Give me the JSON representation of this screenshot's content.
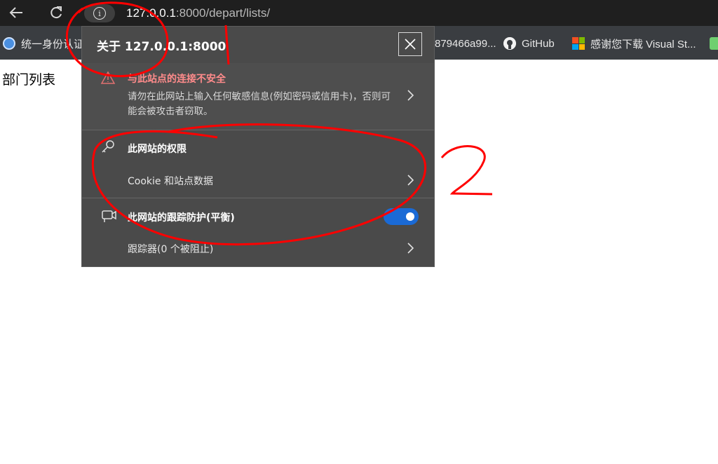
{
  "browser": {
    "back_icon": "arrow-left-icon",
    "reload_icon": "reload-icon",
    "info_icon": "info-icon",
    "url_host": "127.0.0.1",
    "url_port_path": ":8000/depart/lists/"
  },
  "bookmarks": [
    {
      "label": "统一身份认证",
      "icon": "globe-icon"
    },
    {
      "label": "879466a99...",
      "icon": ""
    },
    {
      "label": "GitHub",
      "icon": "github-icon"
    },
    {
      "label": "感谢您下载 Visual St...",
      "icon": "microsoft-icon"
    },
    {
      "label": "",
      "icon": "bookmark-icon"
    }
  ],
  "page": {
    "heading": "部门列表"
  },
  "site_info": {
    "title": "关于 127.0.0.1:8000",
    "close_icon": "close-icon",
    "warning_title": "与此站点的连接不安全",
    "warning_body": "请勿在此网站上输入任何敏感信息(例如密码或信用卡)，否则可能会被攻击者窃取。",
    "permissions_title": "此网站的权限",
    "cookie_label": "Cookie 和站点数据",
    "tracking_title": "此网站的跟踪防护(平衡)",
    "tracking_enabled": true,
    "trackers_label": "跟踪器(0 个被阻止)"
  },
  "annotations": {
    "marker_1": "1",
    "marker_2": "2",
    "ink_color": "#ff0000"
  },
  "colors": {
    "toolbar_bg": "#1f1f1f",
    "bookmarks_bg": "#3a3d41",
    "popup_bg": "#4a4a4a",
    "warning_text": "#ff8b8b",
    "toggle_on": "#1a6ad6"
  }
}
